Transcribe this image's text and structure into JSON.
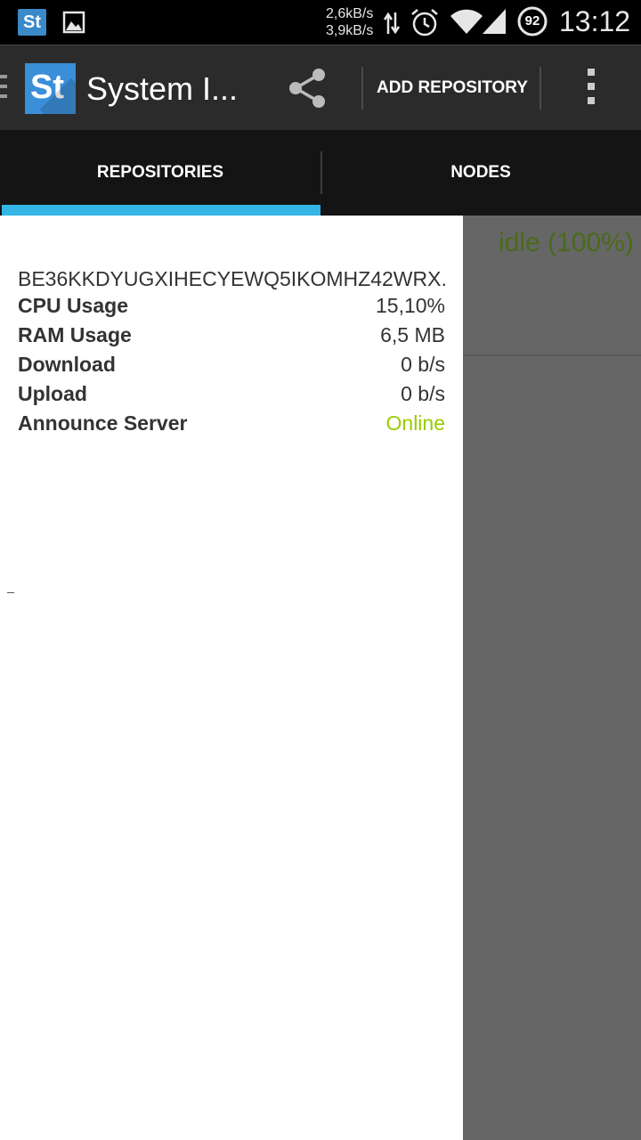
{
  "status_bar": {
    "app_icon_label": "St",
    "speed_up": "2,6kB/s",
    "speed_down": "3,9kB/s",
    "battery_level": "92",
    "time": "13:12",
    "icons": [
      "syncthing-app-icon",
      "image-icon",
      "data-transfer-icon",
      "alarm-icon",
      "wifi-icon",
      "cell-signal-icon",
      "battery-icon"
    ]
  },
  "action_bar": {
    "logo_text": "St",
    "title": "System I...",
    "share_icon": "share-icon",
    "add_repository_label": "ADD REPOSITORY",
    "overflow_icon": "overflow-menu-icon"
  },
  "tabs": [
    {
      "label": "REPOSITORIES",
      "selected": true
    },
    {
      "label": "NODES",
      "selected": false
    }
  ],
  "colors": {
    "tab_indicator": "#33b5e5",
    "online": "#99cc00",
    "logo": "#3b8fd9"
  },
  "repository": {
    "status": "idle (100%)"
  },
  "drawer": {
    "node_id": "BE36KKDYUGXIHECYEWQ5IKOMHZ42WRX...",
    "rows": [
      {
        "label": "CPU Usage",
        "value": "15,10%"
      },
      {
        "label": "RAM Usage",
        "value": "6,5 MB"
      },
      {
        "label": "Download",
        "value": "0 b/s"
      },
      {
        "label": "Upload",
        "value": "0 b/s"
      },
      {
        "label": "Announce Server",
        "value": "Online"
      }
    ]
  }
}
